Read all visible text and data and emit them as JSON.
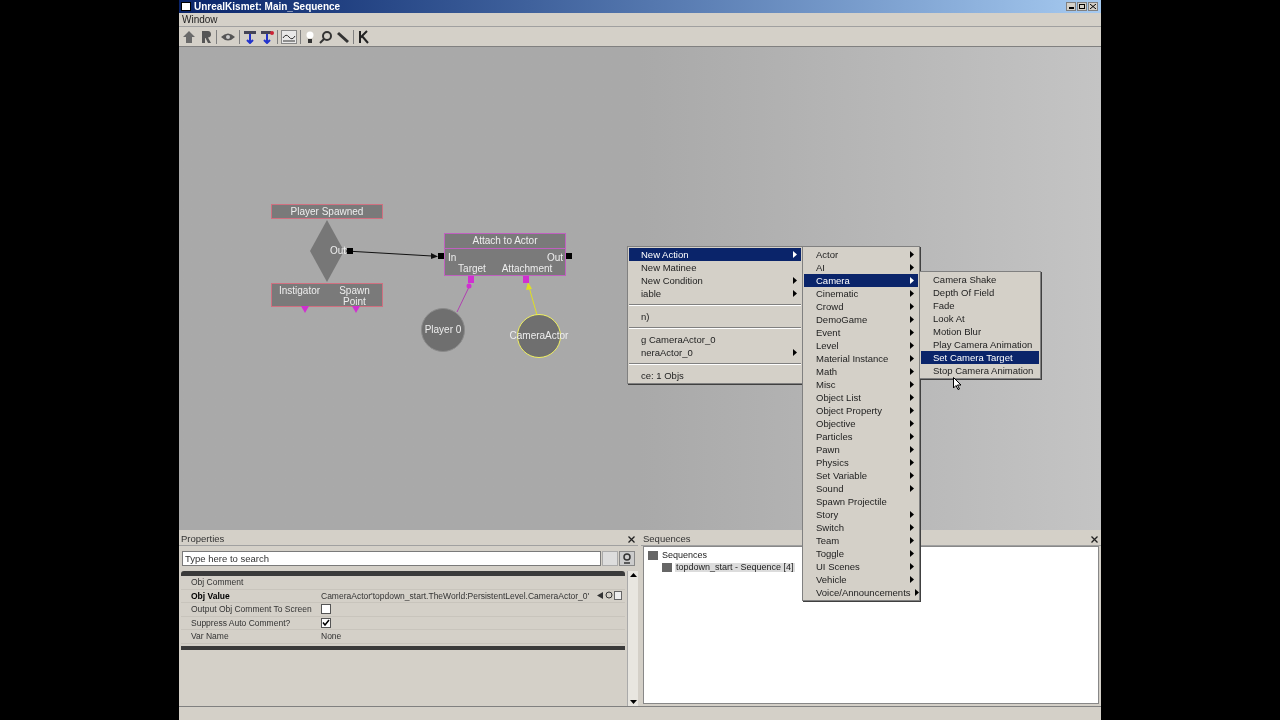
{
  "window": {
    "title": "UnrealKismet: Main_Sequence"
  },
  "menu_bar": [
    "Window"
  ],
  "canvas": {
    "nodes": [
      {
        "kind": "event",
        "title": "Player Spawned",
        "outputs": [
          "Out"
        ],
        "variables": [
          "Instigator",
          "Spawn Point"
        ]
      },
      {
        "kind": "action",
        "title": "Attach to Actor",
        "inputs": [
          "In"
        ],
        "outputs": [
          "Out"
        ],
        "variables": [
          "Target",
          "Attachment"
        ]
      },
      {
        "kind": "variable",
        "label": "Player 0",
        "selected": false
      },
      {
        "kind": "variable",
        "label": "CameraActor",
        "selected": true
      }
    ]
  },
  "context_menu": [
    {
      "kind": "item",
      "label": "New Action",
      "submenu": true,
      "selected": true
    },
    {
      "kind": "item",
      "label": "New Matinee",
      "submenu": false,
      "selected": false
    },
    {
      "kind": "item",
      "label": "New Condition",
      "submenu": true,
      "selected": false
    },
    {
      "kind": "item",
      "label": "iable",
      "submenu": true,
      "selected": false
    },
    {
      "kind": "separator"
    },
    {
      "kind": "item",
      "label": "n)",
      "submenu": false,
      "selected": false
    },
    {
      "kind": "separator"
    },
    {
      "kind": "item",
      "label": "g CameraActor_0",
      "submenu": false,
      "selected": false
    },
    {
      "kind": "item",
      "label": "neraActor_0",
      "submenu": true,
      "selected": false
    },
    {
      "kind": "separator"
    },
    {
      "kind": "item",
      "label": "ce: 1 Objs",
      "submenu": false,
      "selected": false
    }
  ],
  "action_submenu": [
    {
      "label": "Actor",
      "submenu": true,
      "selected": false
    },
    {
      "label": "AI",
      "submenu": true,
      "selected": false
    },
    {
      "label": "Camera",
      "submenu": true,
      "selected": true
    },
    {
      "label": "Cinematic",
      "submenu": true,
      "selected": false
    },
    {
      "label": "Crowd",
      "submenu": true,
      "selected": false
    },
    {
      "label": "DemoGame",
      "submenu": true,
      "selected": false
    },
    {
      "label": "Event",
      "submenu": true,
      "selected": false
    },
    {
      "label": "Level",
      "submenu": true,
      "selected": false
    },
    {
      "label": "Material Instance",
      "submenu": true,
      "selected": false
    },
    {
      "label": "Math",
      "submenu": true,
      "selected": false
    },
    {
      "label": "Misc",
      "submenu": true,
      "selected": false
    },
    {
      "label": "Object List",
      "submenu": true,
      "selected": false
    },
    {
      "label": "Object Property",
      "submenu": true,
      "selected": false
    },
    {
      "label": "Objective",
      "submenu": true,
      "selected": false
    },
    {
      "label": "Particles",
      "submenu": true,
      "selected": false
    },
    {
      "label": "Pawn",
      "submenu": true,
      "selected": false
    },
    {
      "label": "Physics",
      "submenu": true,
      "selected": false
    },
    {
      "label": "Set Variable",
      "submenu": true,
      "selected": false
    },
    {
      "label": "Sound",
      "submenu": true,
      "selected": false
    },
    {
      "label": "Spawn Projectile",
      "submenu": false,
      "selected": false
    },
    {
      "label": "Story",
      "submenu": true,
      "selected": false
    },
    {
      "label": "Switch",
      "submenu": true,
      "selected": false
    },
    {
      "label": "Team",
      "submenu": true,
      "selected": false
    },
    {
      "label": "Toggle",
      "submenu": true,
      "selected": false
    },
    {
      "label": "UI Scenes",
      "submenu": true,
      "selected": false
    },
    {
      "label": "Vehicle",
      "submenu": true,
      "selected": false
    },
    {
      "label": "Voice/Announcements",
      "submenu": true,
      "selected": false
    }
  ],
  "camera_submenu": [
    {
      "label": "Camera Shake",
      "selected": false
    },
    {
      "label": "Depth Of Field",
      "selected": false
    },
    {
      "label": "Fade",
      "selected": false
    },
    {
      "label": "Look At",
      "selected": false
    },
    {
      "label": "Motion Blur",
      "selected": false
    },
    {
      "label": "Play Camera Animation",
      "selected": false
    },
    {
      "label": "Set Camera Target",
      "selected": true
    },
    {
      "label": "Stop Camera Animation",
      "selected": false
    }
  ],
  "properties": {
    "title": "Properties",
    "search": {
      "placeholder": "Type here to search"
    },
    "rows": [
      {
        "kind": "text",
        "label": "Obj Comment",
        "modified": false
      },
      {
        "kind": "text",
        "label": "Obj Value",
        "value": "CameraActor'topdown_start.TheWorld:PersistentLevel.CameraActor_0'",
        "modified": true
      },
      {
        "kind": "checkbox",
        "label": "Output Obj Comment To Screen",
        "checked": false,
        "modified": false
      },
      {
        "kind": "checkbox",
        "label": "Suppress Auto Comment?",
        "checked": true,
        "modified": false
      },
      {
        "kind": "text",
        "label": "Var Name",
        "value": "None",
        "modified": false
      }
    ]
  },
  "sequences": {
    "title": "Sequences",
    "tree": [
      {
        "label": "Sequences",
        "selected": false,
        "children": [
          {
            "label": "topdown_start - Sequence [4]",
            "selected": true
          }
        ]
      }
    ]
  }
}
